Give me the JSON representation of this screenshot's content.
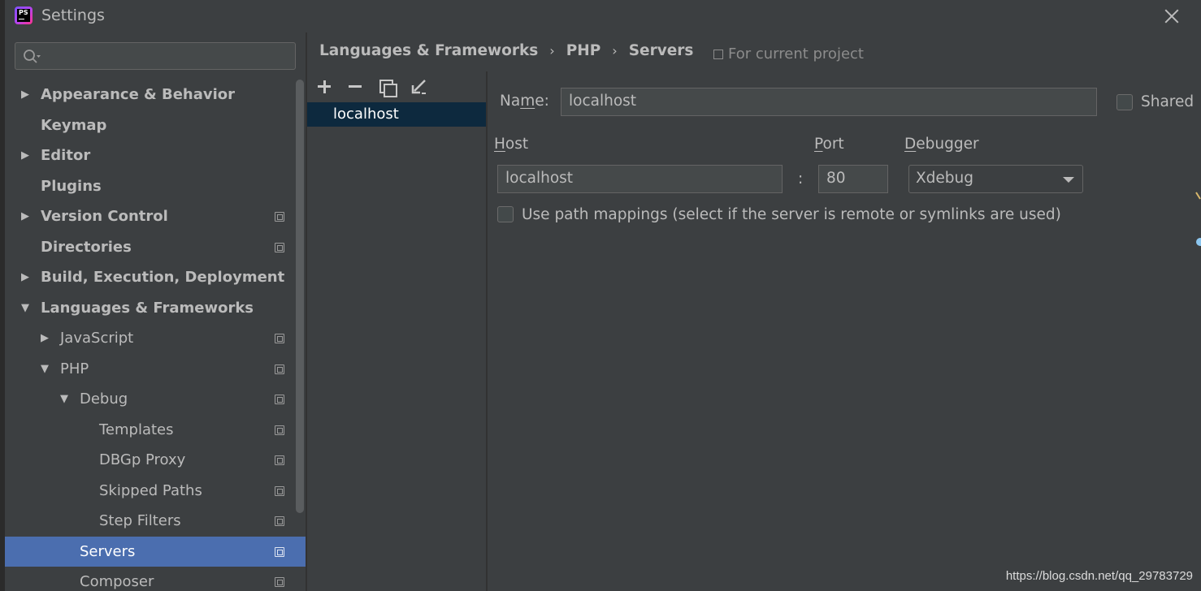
{
  "window": {
    "title": "Settings"
  },
  "search": {
    "placeholder": ""
  },
  "tree": [
    {
      "label": "Appearance & Behavior",
      "indent": 0,
      "arrow": "right",
      "bold": true,
      "project": false,
      "selected": false
    },
    {
      "label": "Keymap",
      "indent": 0,
      "arrow": "",
      "bold": true,
      "project": false,
      "selected": false
    },
    {
      "label": "Editor",
      "indent": 0,
      "arrow": "right",
      "bold": true,
      "project": false,
      "selected": false
    },
    {
      "label": "Plugins",
      "indent": 0,
      "arrow": "",
      "bold": true,
      "project": false,
      "selected": false
    },
    {
      "label": "Version Control",
      "indent": 0,
      "arrow": "right",
      "bold": true,
      "project": true,
      "selected": false
    },
    {
      "label": "Directories",
      "indent": 0,
      "arrow": "",
      "bold": true,
      "project": true,
      "selected": false
    },
    {
      "label": "Build, Execution, Deployment",
      "indent": 0,
      "arrow": "right",
      "bold": true,
      "project": false,
      "selected": false
    },
    {
      "label": "Languages & Frameworks",
      "indent": 0,
      "arrow": "down",
      "bold": true,
      "project": false,
      "selected": false
    },
    {
      "label": "JavaScript",
      "indent": 1,
      "arrow": "right",
      "bold": false,
      "project": true,
      "selected": false
    },
    {
      "label": "PHP",
      "indent": 1,
      "arrow": "down",
      "bold": false,
      "project": true,
      "selected": false
    },
    {
      "label": "Debug",
      "indent": 2,
      "arrow": "down",
      "bold": false,
      "project": true,
      "selected": false
    },
    {
      "label": "Templates",
      "indent": 3,
      "arrow": "",
      "bold": false,
      "project": true,
      "selected": false
    },
    {
      "label": "DBGp Proxy",
      "indent": 3,
      "arrow": "",
      "bold": false,
      "project": true,
      "selected": false
    },
    {
      "label": "Skipped Paths",
      "indent": 3,
      "arrow": "",
      "bold": false,
      "project": true,
      "selected": false
    },
    {
      "label": "Step Filters",
      "indent": 3,
      "arrow": "",
      "bold": false,
      "project": true,
      "selected": false
    },
    {
      "label": "Servers",
      "indent": 2,
      "arrow": "",
      "bold": false,
      "project": true,
      "selected": true
    },
    {
      "label": "Composer",
      "indent": 2,
      "arrow": "",
      "bold": false,
      "project": true,
      "selected": false
    }
  ],
  "breadcrumb": {
    "items": [
      "Languages & Frameworks",
      "PHP",
      "Servers"
    ],
    "separator": "›"
  },
  "for_project": "For current project",
  "servers": {
    "items": [
      "localhost"
    ]
  },
  "form": {
    "name_label_pre": "Na",
    "name_label_u": "m",
    "name_label_post": "e:",
    "name_value": "localhost",
    "shared_label": "Shared",
    "host_label_u": "H",
    "host_label_post": "ost",
    "host_value": "localhost",
    "colon": ":",
    "port_label_u": "P",
    "port_label_post": "ort",
    "port_value": "80",
    "debugger_label_u": "D",
    "debugger_label_post": "ebugger",
    "debugger_value": "Xdebug",
    "path_mappings_label": "Use path mappings (select if the server is remote or symlinks are used)"
  },
  "watermark": "https://blog.csdn.net/qq_29783729",
  "colors": {
    "selection": "#4b6eaf",
    "list_selection": "#0d293e",
    "background": "#3c3f41"
  }
}
